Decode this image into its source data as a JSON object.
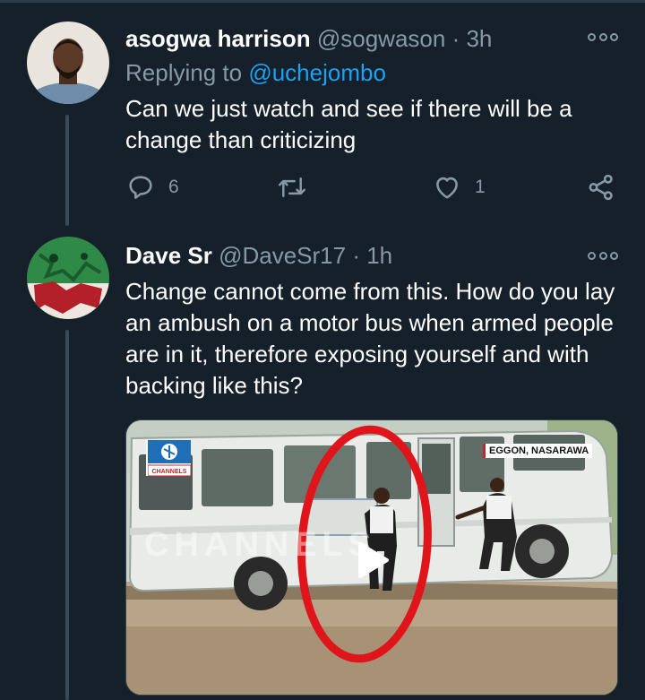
{
  "tweets": [
    {
      "name": "asogwa harrison",
      "handle": "@sogwason",
      "time": "· 3h",
      "replying_prefix": "Replying to ",
      "replying_to": "@uchejombo",
      "text": "Can we just watch and see if there will be a change than criticizing",
      "replies": "6",
      "retweets": "",
      "likes": "1",
      "avatar_icon": "profile-photo"
    },
    {
      "name": "Dave Sr",
      "handle": "@DaveSr17",
      "time": "· 1h",
      "text": "Change cannot come from this. How do you lay an ambush on a motor bus when armed people are in it, therefore exposing yourself and with backing like this?",
      "avatar_icon": "flag-profile-photo",
      "media": {
        "location_tag": "EGGON, NASARAWA",
        "watermark": "CHANNELS",
        "logo_text": "CHANNELS",
        "play_icon": "play-icon"
      }
    }
  ],
  "colors": {
    "background": "#15202b",
    "secondary_text": "#8899a6",
    "link": "#1da1f2",
    "annotation_circle": "#e0141b"
  }
}
